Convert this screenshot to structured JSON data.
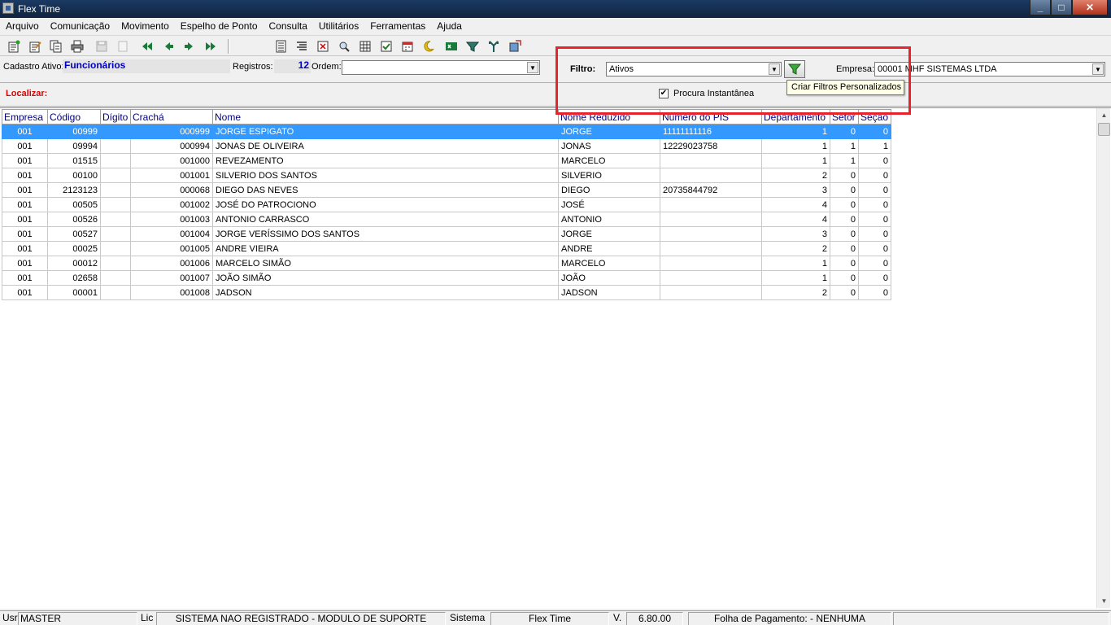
{
  "window": {
    "title": "Flex Time"
  },
  "menu": [
    "Arquivo",
    "Comunicação",
    "Movimento",
    "Espelho de Ponto",
    "Consulta",
    "Utilitários",
    "Ferramentas",
    "Ajuda"
  ],
  "info": {
    "cadastro_label": "Cadastro Ativo:",
    "cadastro_value": "Funcionários",
    "registros_label": "Registros:",
    "registros_value": "12",
    "ordem_label": "Ordem:",
    "ordem_value": ""
  },
  "filter": {
    "label": "Filtro:",
    "value": "Ativos",
    "button_tooltip": "Criar Filtros Personalizados",
    "procura_label": "Procura Instantânea",
    "procura_checked": true,
    "empresa_label": "Empresa:",
    "empresa_value": "00001 MHF SISTEMAS LTDA"
  },
  "localizar_label": "Localizar:",
  "grid": {
    "columns": [
      "Empresa",
      "Código",
      "Dígito",
      "Crachá",
      "Nome",
      "Nome Reduzido",
      "Número do PIS",
      "Departamento",
      "Setor",
      "Seção"
    ],
    "rows": [
      [
        "001",
        "00999",
        "",
        "000999",
        "JORGE ESPIGATO",
        "JORGE",
        "11111111116",
        "1",
        "0",
        "0"
      ],
      [
        "001",
        "09994",
        "",
        "000994",
        "JONAS DE OLIVEIRA",
        "JONAS",
        "12229023758",
        "1",
        "1",
        "1"
      ],
      [
        "001",
        "01515",
        "",
        "001000",
        "REVEZAMENTO",
        "MARCELO",
        "",
        "1",
        "1",
        "0"
      ],
      [
        "001",
        "00100",
        "",
        "001001",
        "SILVERIO DOS SANTOS",
        "SILVERIO",
        "",
        "2",
        "0",
        "0"
      ],
      [
        "001",
        "2123123",
        "",
        "000068",
        "DIEGO DAS NEVES",
        "DIEGO",
        "20735844792",
        "3",
        "0",
        "0"
      ],
      [
        "001",
        "00505",
        "",
        "001002",
        "JOSÉ DO PATROCIONO",
        "JOSÉ",
        "",
        "4",
        "0",
        "0"
      ],
      [
        "001",
        "00526",
        "",
        "001003",
        "ANTONIO CARRASCO",
        "ANTONIO",
        "",
        "4",
        "0",
        "0"
      ],
      [
        "001",
        "00527",
        "",
        "001004",
        "JORGE VERÍSSIMO DOS SANTOS",
        "JORGE",
        "",
        "3",
        "0",
        "0"
      ],
      [
        "001",
        "00025",
        "",
        "001005",
        "ANDRE VIEIRA",
        "ANDRE",
        "",
        "2",
        "0",
        "0"
      ],
      [
        "001",
        "00012",
        "",
        "001006",
        "MARCELO SIMÃO",
        "MARCELO",
        "",
        "1",
        "0",
        "0"
      ],
      [
        "001",
        "02658",
        "",
        "001007",
        "JOÃO SIMÃO",
        "JOÃO",
        "",
        "1",
        "0",
        "0"
      ],
      [
        "001",
        "00001",
        "",
        "001008",
        "JADSON",
        "JADSON",
        "",
        "2",
        "0",
        "0"
      ]
    ],
    "selected_row": 0
  },
  "status": {
    "usr_label": "Usr",
    "usr_value": "MASTER",
    "lic_label": "Lic",
    "lic_value": "SISTEMA NAO REGISTRADO - MODULO DE SUPORTE",
    "sistema_label": "Sistema",
    "sistema_value": "Flex Time",
    "version_label": "V.",
    "version_value": "6.80.00",
    "folha_value": "Folha de Pagamento:  - NENHUMA"
  },
  "colors": {
    "highlight": "#e8232b",
    "selection": "#3399ff",
    "link_blue": "#0000c0",
    "alert_red": "#e00000"
  }
}
